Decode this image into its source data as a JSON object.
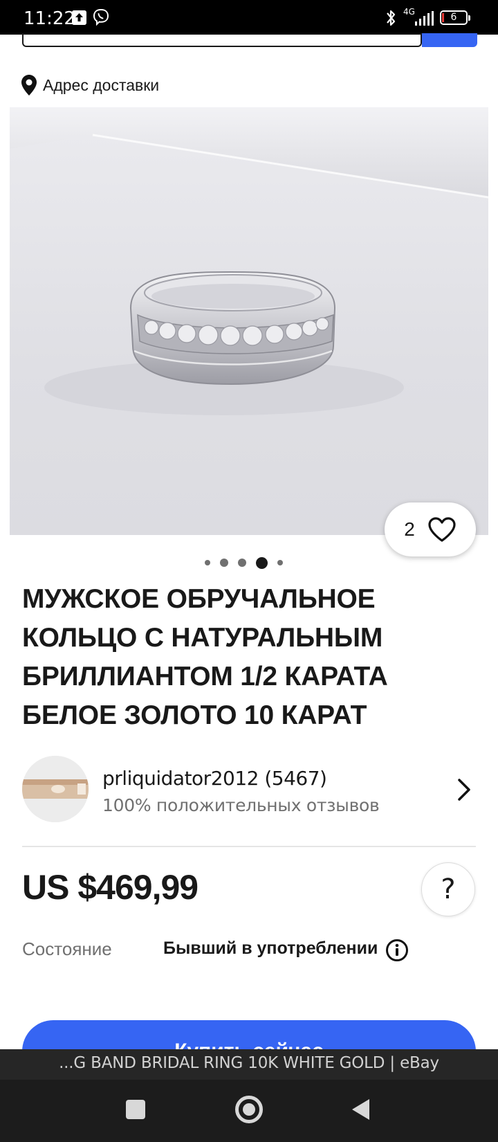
{
  "status_bar": {
    "time": "11:22",
    "network": "4G",
    "battery": "6"
  },
  "address": {
    "label": "Адрес доставки",
    "icon": "location-pin-icon"
  },
  "gallery": {
    "image_count": 5,
    "active_index": 3
  },
  "watch": {
    "count": "2",
    "icon": "heart-icon"
  },
  "item": {
    "title": "МУЖСКОЕ ОБРУЧАЛЬНОЕ КОЛЬЦО С НАТУРАЛЬНЫМ БРИЛЛИАНТОМ 1/2 КАРАТА БЕЛОЕ ЗОЛОТО 10 КАРАТ",
    "price": "US $469,99",
    "condition_label": "Состояние",
    "condition_value": "Бывший в употреблении"
  },
  "seller": {
    "name": "prliquidator2012 (5467)",
    "feedback": "100% положительных отзывов"
  },
  "help_label": "?",
  "buy_now_label": "Купить сейчас",
  "page_title": "...G BAND BRIDAL RING 10K WHITE GOLD | eBay",
  "colors": {
    "accent": "#3665f3",
    "text": "#191919",
    "secondary_text": "#707070"
  }
}
